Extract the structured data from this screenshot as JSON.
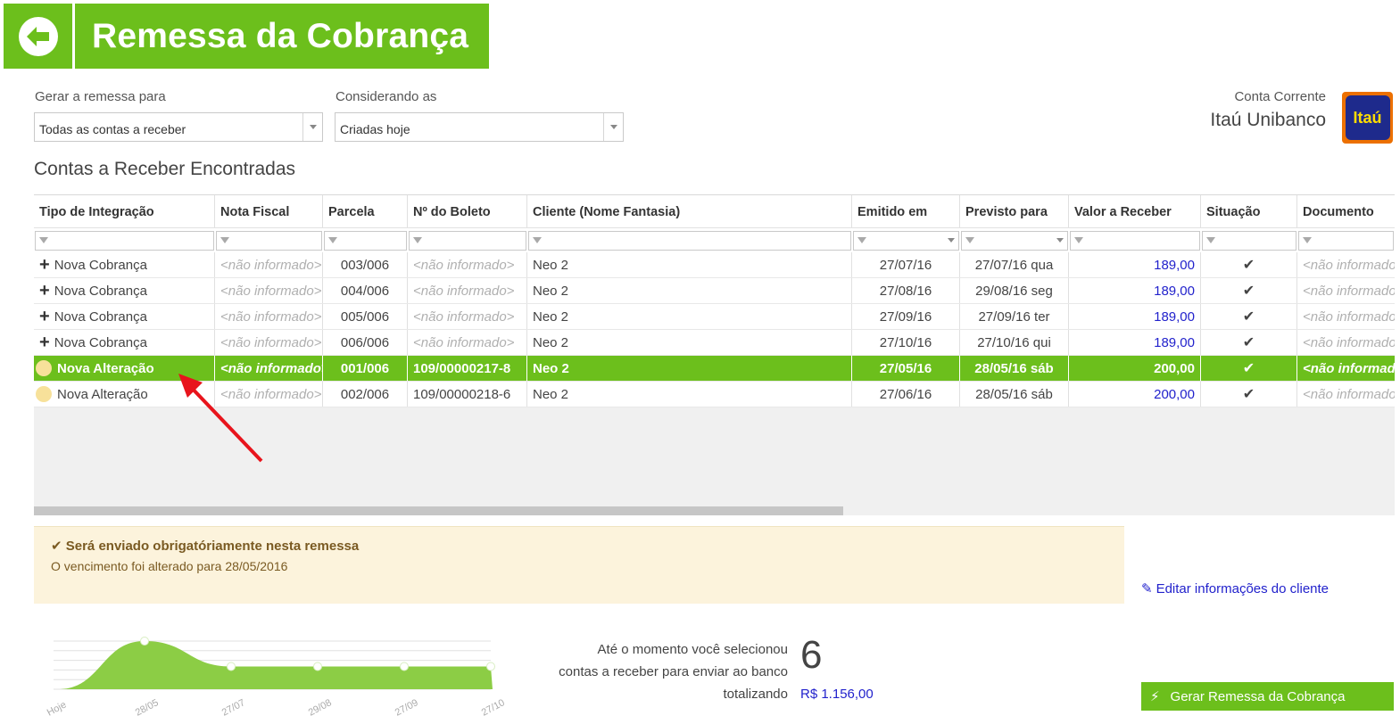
{
  "header": {
    "title": "Remessa da Cobrança"
  },
  "filters": {
    "gerar_label": "Gerar a remessa para",
    "gerar_value": "Todas as contas a receber",
    "considerando_label": "Considerando as",
    "considerando_value": "Criadas hoje"
  },
  "account": {
    "label": "Conta Corrente",
    "name": "Itaú Unibanco",
    "logo_text": "Itaú"
  },
  "section_title": "Contas a Receber Encontradas",
  "table": {
    "columns": [
      "Tipo de Integração",
      "Nota Fiscal",
      "Parcela",
      "Nº do Boleto",
      "Cliente (Nome Fantasia)",
      "Emitido em",
      "Previsto para",
      "Valor a Receber",
      "Situação",
      "Documento"
    ],
    "rows": [
      {
        "tipo": "Nova Cobrança",
        "nota": "<não informado>",
        "parcela": "003/006",
        "boleto": "<não informado>",
        "cliente": "Neo 2",
        "emitido": "27/07/16",
        "previsto": "27/07/16 qua",
        "valor": "189,00",
        "situacao": "✔",
        "documento": "<não informado>"
      },
      {
        "tipo": "Nova Cobrança",
        "nota": "<não informado>",
        "parcela": "004/006",
        "boleto": "<não informado>",
        "cliente": "Neo 2",
        "emitido": "27/08/16",
        "previsto": "29/08/16 seg",
        "valor": "189,00",
        "situacao": "✔",
        "documento": "<não informado>"
      },
      {
        "tipo": "Nova Cobrança",
        "nota": "<não informado>",
        "parcela": "005/006",
        "boleto": "<não informado>",
        "cliente": "Neo 2",
        "emitido": "27/09/16",
        "previsto": "27/09/16 ter",
        "valor": "189,00",
        "situacao": "✔",
        "documento": "<não informado>"
      },
      {
        "tipo": "Nova Cobrança",
        "nota": "<não informado>",
        "parcela": "006/006",
        "boleto": "<não informado>",
        "cliente": "Neo 2",
        "emitido": "27/10/16",
        "previsto": "27/10/16 qui",
        "valor": "189,00",
        "situacao": "✔",
        "documento": "<não informado>"
      },
      {
        "tipo": "Nova Alteração",
        "nota": "<não informado>",
        "parcela": "001/006",
        "boleto": "109/00000217-8",
        "cliente": "Neo 2",
        "emitido": "27/05/16",
        "previsto": "28/05/16 sáb",
        "valor": "200,00",
        "situacao": "✔",
        "documento": "<não informado>"
      },
      {
        "tipo": "Nova Alteração",
        "nota": "<não informado>",
        "parcela": "002/006",
        "boleto": "109/00000218-6",
        "cliente": "Neo 2",
        "emitido": "27/06/16",
        "previsto": "28/05/16 sáb",
        "valor": "200,00",
        "situacao": "✔",
        "documento": "<não informado>"
      }
    ]
  },
  "notice": {
    "title": "Será enviado obrigatóriamente nesta remessa",
    "subtitle": "O vencimento foi alterado para 28/05/2016"
  },
  "edit_link": "Editar informações do cliente",
  "chart_data": {
    "type": "area",
    "categories": [
      "Hoje",
      "28/05",
      "27/07",
      "29/08",
      "27/09",
      "27/10"
    ],
    "values": [
      0,
      400,
      189,
      189,
      189,
      189
    ],
    "ylim": [
      0,
      400
    ]
  },
  "summary": {
    "line1": "Até o momento você selecionou",
    "line2": "contas a receber para enviar ao banco",
    "line3": "totalizando",
    "count": "6",
    "total": "R$ 1.156,00"
  },
  "generate_button": "Gerar Remessa da Cobrança",
  "colors": {
    "accent": "#6cbf1c",
    "link": "#2222cc",
    "notice_bg": "#fcf3dc"
  }
}
